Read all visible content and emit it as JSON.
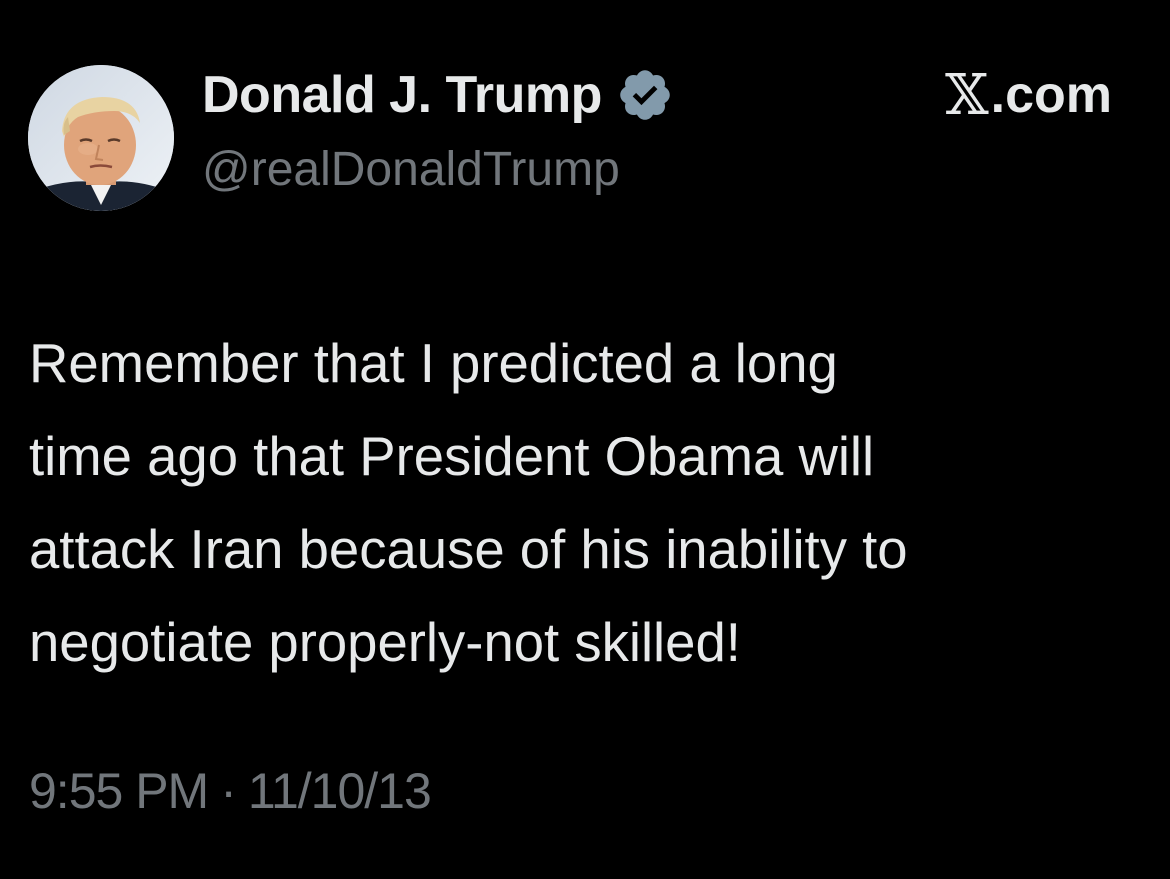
{
  "tweet": {
    "author": {
      "display_name": "Donald J. Trump",
      "handle": "@realDonaldTrump",
      "verified": true,
      "avatar_icon": "profile-photo-avatar"
    },
    "brand": {
      "x_glyph": "𝕏",
      "suffix": ".com"
    },
    "text_lines": [
      "Remember that I predicted a long",
      "time ago that President Obama will",
      "attack Iran because of his inability to",
      "negotiate properly-not skilled!"
    ],
    "time": "9:55 PM",
    "separator": "·",
    "date": "11/10/13"
  },
  "colors": {
    "background": "#000000",
    "primary_text": "#e7e9ea",
    "secondary_text": "#71767b",
    "verified_badge": "#829aab"
  },
  "icons": {
    "verified": "verified-badge-icon"
  }
}
